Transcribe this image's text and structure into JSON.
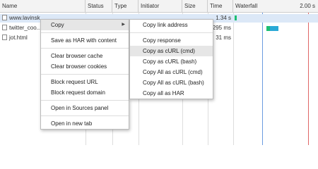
{
  "columns": {
    "name": "Name",
    "status": "Status",
    "type": "Type",
    "initiator": "Initiator",
    "size": "Size",
    "time": "Time",
    "waterfall": "Waterfall",
    "waterfall_tick": "2.00 s"
  },
  "rows": [
    {
      "name": "www.lavinsk...",
      "status": "",
      "type": "",
      "initiator": "",
      "size": "",
      "time": "1.34 s",
      "selected": true
    },
    {
      "name": "twitter_coo...",
      "status": "",
      "type": "",
      "initiator": "",
      "size": "",
      "time": "295 ms",
      "selected": false
    },
    {
      "name": "jot.html",
      "status": "",
      "type": "",
      "initiator": "",
      "size": "",
      "time": "31 ms",
      "selected": false
    }
  ],
  "waterfall": {
    "blue_marker_color": "#6b9be0",
    "red_marker_color": "#e06666",
    "bar_colors": [
      "#1dbf73",
      "#2aa9d6",
      "#1dbf73"
    ]
  },
  "context_menu": {
    "copy": "Copy",
    "save_har": "Save as HAR with content",
    "clear_cache": "Clear browser cache",
    "clear_cookies": "Clear browser cookies",
    "block_url": "Block request URL",
    "block_domain": "Block request domain",
    "open_sources": "Open in Sources panel",
    "open_tab": "Open in new tab"
  },
  "copy_submenu": {
    "link_address": "Copy link address",
    "response": "Copy response",
    "curl_cmd": "Copy as cURL (cmd)",
    "curl_bash": "Copy as cURL (bash)",
    "all_curl_cmd": "Copy All as cURL (cmd)",
    "all_curl_bash": "Copy All as cURL (bash)",
    "all_har": "Copy all as HAR"
  }
}
